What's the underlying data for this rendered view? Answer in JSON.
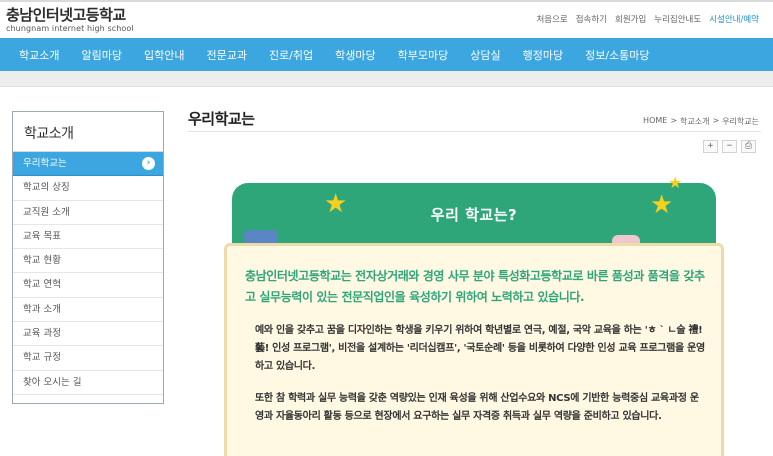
{
  "header": {
    "logo_title": "충남인터넷고등학교",
    "logo_sub": "chungnam internet high school",
    "util_links": [
      "처음으로",
      "접속하기",
      "회원가입",
      "누리집안내도",
      "시설안내/예약"
    ]
  },
  "gnb": {
    "items": [
      "학교소개",
      "알림마당",
      "입학안내",
      "전문교과",
      "진로/취업",
      "학생마당",
      "학부모마당",
      "상담실",
      "행정마당",
      "정보/소통마당"
    ]
  },
  "lnb": {
    "title": "학교소개",
    "items": [
      "우리학교는",
      "학교의 상징",
      "교직원 소개",
      "교육 목표",
      "학교 현황",
      "학교 연혁",
      "학과 소개",
      "교육 과정",
      "학교 규정",
      "찾아 오시는 길"
    ],
    "active_arrow": "›"
  },
  "content": {
    "page_title": "우리학교는",
    "breadcrumb": [
      "HOME",
      ">",
      "학교소개",
      ">",
      "우리학교는"
    ],
    "tools": [
      "+",
      "−",
      "⎙"
    ],
    "banner_title": "우리 학교는?",
    "lead": "충남인터넷고등학교는 전자상거래와 경영 사무 분야 특성화고등학교로 바른 품성과 품격을 갖추고 실무능력이 있는 전문직업인을 육성하기 위하여 노력하고 있습니다.",
    "para1": "예와 인을 갖추고 꿈을 디자인하는 학생을 키우기 위하여 학년별로 연극, 예절, 국악 교육을 하는 'ㅎ ` ㄴ술 禮!藝! 인성 프로그램', 비전을 설계하는 '리더십캠프', '국토순례' 등을 비롯하여 다양한 인성 교육 프로그램을 운영하고 있습니다.",
    "para2": "또한 참 학력과 실무 능력을 갖춘 역량있는 인재 육성을 위해 산업수요와 NCS에 기반한 능력중심 교육과정 운영과 자율동아리 활동 등으로 현장에서 요구하는 실무 자격증 취득과 실무 역량을 준비하고 있습니다."
  },
  "colors": {
    "nav_blue": "#3ba6e0",
    "banner_green": "#2ea67a",
    "star_yellow": "#f7cf1d",
    "paper": "#fff8e3"
  }
}
